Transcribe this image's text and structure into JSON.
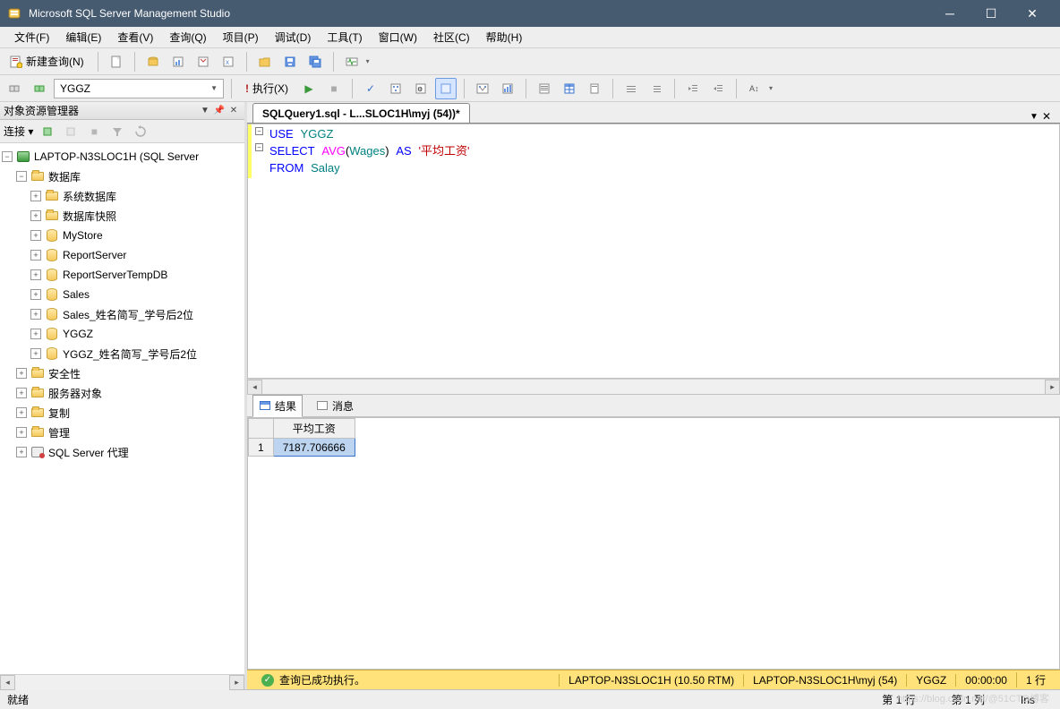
{
  "title": "Microsoft SQL Server Management Studio",
  "menu": {
    "file": "文件(F)",
    "edit": "编辑(E)",
    "view": "查看(V)",
    "query": "查询(Q)",
    "project": "项目(P)",
    "debug": "调试(D)",
    "tools": "工具(T)",
    "window": "窗口(W)",
    "community": "社区(C)",
    "help": "帮助(H)"
  },
  "toolbar1": {
    "new_query": "新建查询(N)"
  },
  "toolbar2": {
    "database": "YGGZ",
    "execute": "执行(X)"
  },
  "object_explorer": {
    "title": "对象资源管理器",
    "connect_label": "连接 ▾",
    "root": "LAPTOP-N3SLOC1H (SQL Server",
    "databases": "数据库",
    "system_databases": "系统数据库",
    "database_snapshots": "数据库快照",
    "db_list": [
      "MyStore",
      "ReportServer",
      "ReportServerTempDB",
      "Sales",
      "Sales_姓名简写_学号后2位",
      "YGGZ",
      "YGGZ_姓名简写_学号后2位"
    ],
    "security": "安全性",
    "server_objects": "服务器对象",
    "replication": "复制",
    "management": "管理",
    "agent": "SQL Server 代理"
  },
  "editor": {
    "tab_title": "SQLQuery1.sql - L...SLOC1H\\myj (54))*",
    "sql": {
      "line1": {
        "kw1": "USE",
        "id1": "YGGZ"
      },
      "line2": {
        "kw1": "SELECT",
        "fn1": "AVG",
        "arg": "Wages",
        "kw2": "AS",
        "str": "'平均工资'"
      },
      "line3": {
        "kw1": "FROM",
        "id1": "Salay"
      }
    }
  },
  "results": {
    "tab_results": "结果",
    "tab_messages": "消息",
    "header": "平均工资",
    "row_num": "1",
    "value": "7187.706666"
  },
  "query_status": {
    "message": "查询已成功执行。",
    "server": "LAPTOP-N3SLOC1H (10.50 RTM)",
    "user": "LAPTOP-N3SLOC1H\\myj (54)",
    "database": "YGGZ",
    "elapsed": "00:00:00",
    "rows": "1 行"
  },
  "statusbar": {
    "ready": "就绪",
    "line": "第 1 行",
    "col": "第 1 列",
    "ins": "Ins"
  },
  "watermark": "https://blog.csdn.net/@51CTO博客"
}
